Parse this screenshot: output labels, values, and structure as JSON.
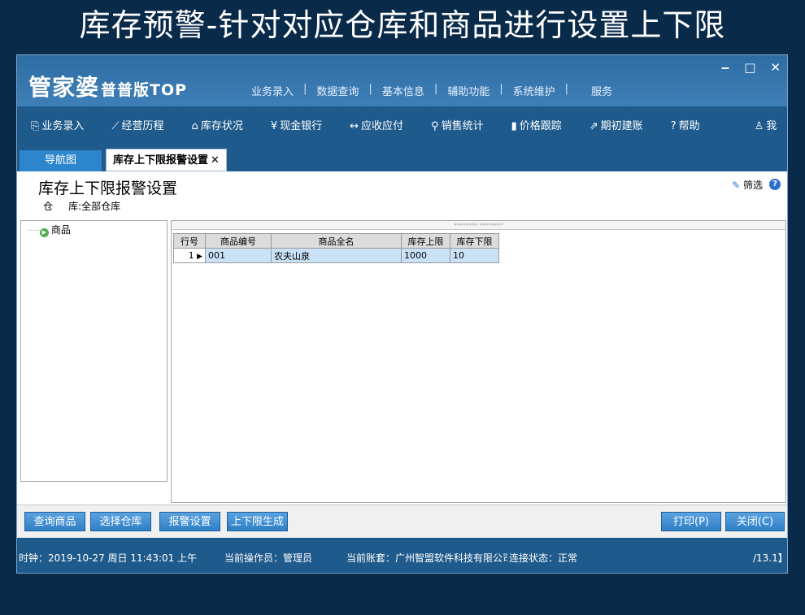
{
  "banner": "库存预警-针对对应仓库和商品进行设置上下限",
  "app": {
    "logo_main": "管家婆",
    "logo_sub": "普普版TOP",
    "top_menu": [
      "业务录入",
      "数据查询",
      "基本信息",
      "辅助功能",
      "系统维护",
      "服务"
    ],
    "window_controls": [
      "‒",
      "□",
      "✕"
    ]
  },
  "toolbar": [
    {
      "icon": "import-icon",
      "glyph": "⎘",
      "label": "业务录入"
    },
    {
      "icon": "chart-icon",
      "glyph": "⟋",
      "label": "经营历程"
    },
    {
      "icon": "home-icon",
      "glyph": "⌂",
      "label": "库存状况"
    },
    {
      "icon": "yen-icon",
      "glyph": "¥",
      "label": "现金银行"
    },
    {
      "icon": "exchange-icon",
      "glyph": "↔",
      "label": "应收应付"
    },
    {
      "icon": "search-icon",
      "glyph": "⚲",
      "label": "销售统计"
    },
    {
      "icon": "bar-chart-icon",
      "glyph": "▮",
      "label": "价格跟踪"
    },
    {
      "icon": "external-icon",
      "glyph": "⇗",
      "label": "期初建账"
    },
    {
      "icon": "help-icon",
      "glyph": "?",
      "label": "帮助"
    },
    {
      "icon": "user-icon",
      "glyph": "♙",
      "label": "我"
    }
  ],
  "tabs": {
    "nav": "导航图",
    "active": "库存上下限报警设置",
    "close": "✕"
  },
  "page": {
    "title": "库存上下限报警设置",
    "warehouse_label": "仓     库:",
    "warehouse_value": "全部仓库",
    "filter_label": "筛选",
    "help_glyph": "?"
  },
  "tree": {
    "root": "商品"
  },
  "grid": {
    "columns": [
      "行号",
      "商品编号",
      "商品全名",
      "库存上限",
      "库存下限"
    ],
    "rows": [
      {
        "row": "1",
        "code": "001",
        "name": "农夫山泉",
        "upper": "1000",
        "lower": "10"
      }
    ]
  },
  "buttons": {
    "query": "查询商品",
    "select_wh": "选择仓库",
    "alarm": "报警设置",
    "generate": "上下限生成",
    "print": "打印(P)",
    "close": "关闭(C)"
  },
  "status": {
    "clock": "时钟：2019-10-27 周日 11:43:01 上午",
    "operator": "当前操作员：管理员",
    "account": "当前账套：广州智盟软件科技有限公司",
    "conn": "连接状态：正常",
    "version": "/13.1】"
  }
}
